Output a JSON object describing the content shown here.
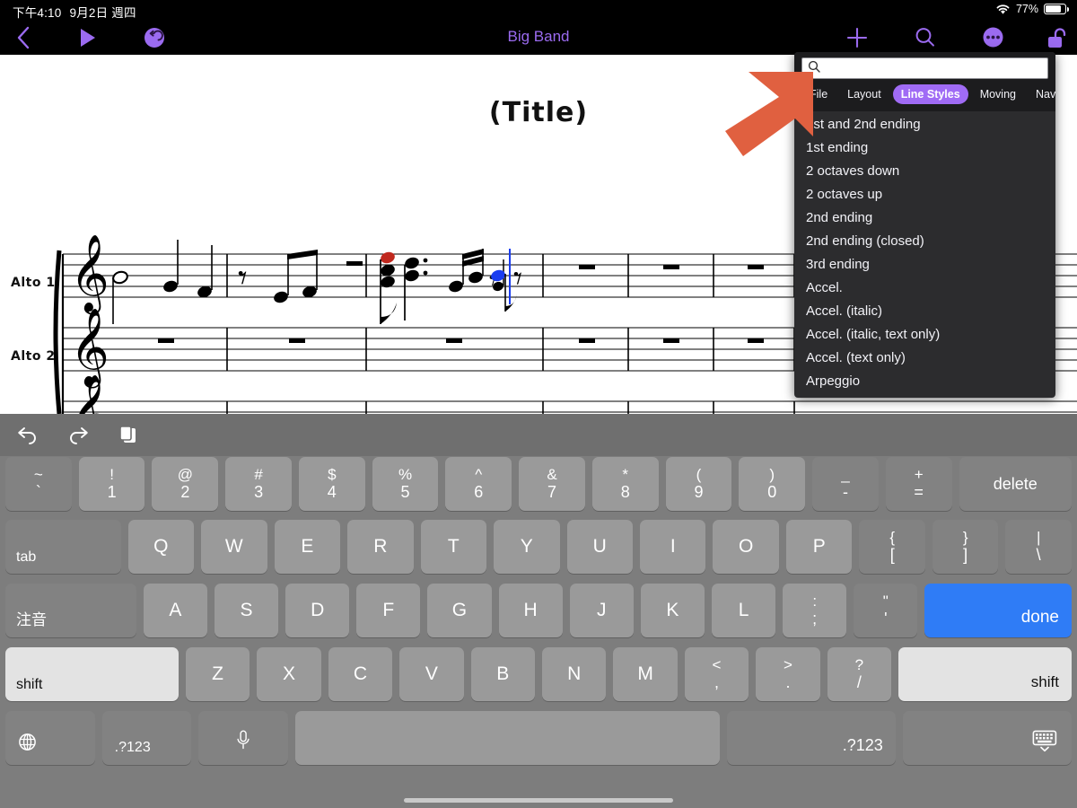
{
  "status_bar": {
    "time": "下午4:10",
    "date": "9月2日 週四",
    "wifi_icon": "wifi-icon",
    "battery_percent": "77%",
    "battery_level": 77
  },
  "toolbar": {
    "title": "Big Band",
    "back_icon": "chevron-left-icon",
    "play_icon": "play-icon",
    "rewind_icon": "rewind-icon",
    "add_icon": "plus-icon",
    "search_icon": "search-icon",
    "more_icon": "more-circle-icon",
    "lock_icon": "unlocked-padlock-icon",
    "accent_color": "#9b6bf0"
  },
  "score": {
    "title": "(Title)",
    "parts": [
      {
        "label": "Alto 1"
      },
      {
        "label": "Alto 2"
      }
    ],
    "selected_note_color": "#1a3df0",
    "highlight_note_color": "#c0281e"
  },
  "popover": {
    "search": {
      "value": "",
      "placeholder": "",
      "icon": "search-icon"
    },
    "tabs": [
      {
        "label": "File",
        "active": false
      },
      {
        "label": "Layout",
        "active": false
      },
      {
        "label": "Line Styles",
        "active": true
      },
      {
        "label": "Moving",
        "active": false
      },
      {
        "label": "Navigati",
        "active": false
      }
    ],
    "active_tab_color": "#a06bf5",
    "items": [
      "1st and 2nd ending",
      "1st ending",
      "2 octaves down",
      "2 octaves up",
      "2nd ending",
      "2nd ending (closed)",
      "3rd ending",
      "Accel.",
      "Accel. (italic)",
      "Accel. (italic, text only)",
      "Accel. (text only)",
      "Arpeggio"
    ]
  },
  "annotation": {
    "arrow_icon": "arrow-up-right-icon",
    "color": "#e06040"
  },
  "keyboard": {
    "toolbar_icons": [
      {
        "name": "undo-icon"
      },
      {
        "name": "redo-icon"
      },
      {
        "name": "paste-icon"
      }
    ],
    "row_numbers": [
      {
        "top": "~",
        "bottom": "`",
        "mod": true
      },
      {
        "top": "!",
        "bottom": "1"
      },
      {
        "top": "@",
        "bottom": "2"
      },
      {
        "top": "#",
        "bottom": "3"
      },
      {
        "top": "$",
        "bottom": "4"
      },
      {
        "top": "%",
        "bottom": "5"
      },
      {
        "top": "^",
        "bottom": "6"
      },
      {
        "top": "&",
        "bottom": "7"
      },
      {
        "top": "*",
        "bottom": "8"
      },
      {
        "top": "(",
        "bottom": "9"
      },
      {
        "top": ")",
        "bottom": "0"
      },
      {
        "top": "_",
        "bottom": "-",
        "mod": true
      },
      {
        "top": "+",
        "bottom": "=",
        "mod": true
      }
    ],
    "delete_label": "delete",
    "row_top": {
      "tab_label": "tab",
      "letters": [
        "Q",
        "W",
        "E",
        "R",
        "T",
        "Y",
        "U",
        "I",
        "O",
        "P"
      ],
      "brackets": [
        {
          "top": "{",
          "bottom": "["
        },
        {
          "top": "}",
          "bottom": "]"
        },
        {
          "top": "|",
          "bottom": "\\"
        }
      ]
    },
    "row_home": {
      "ime_label": "注音",
      "letters": [
        "A",
        "S",
        "D",
        "F",
        "G",
        "H",
        "J",
        "K",
        "L"
      ],
      "punct": [
        {
          "top": ":",
          "bottom": ";"
        },
        {
          "top": "\"",
          "bottom": "'"
        }
      ],
      "done_label": "done"
    },
    "row_bottom": {
      "shift_left_label": "shift",
      "letters": [
        "Z",
        "X",
        "C",
        "V",
        "B",
        "N",
        "M"
      ],
      "punct": [
        {
          "top": "<",
          "bottom": ","
        },
        {
          "top": ">",
          "bottom": "."
        },
        {
          "top": "?",
          "bottom": "/"
        }
      ],
      "shift_right_label": "shift",
      "shift_active": true
    },
    "row_space": {
      "globe_icon": "globe-icon",
      "num_left_label": ".?123",
      "mic_icon": "microphone-icon",
      "space_label": "",
      "num_right_label": ".?123",
      "dismiss_icon": "hide-keyboard-icon"
    }
  }
}
